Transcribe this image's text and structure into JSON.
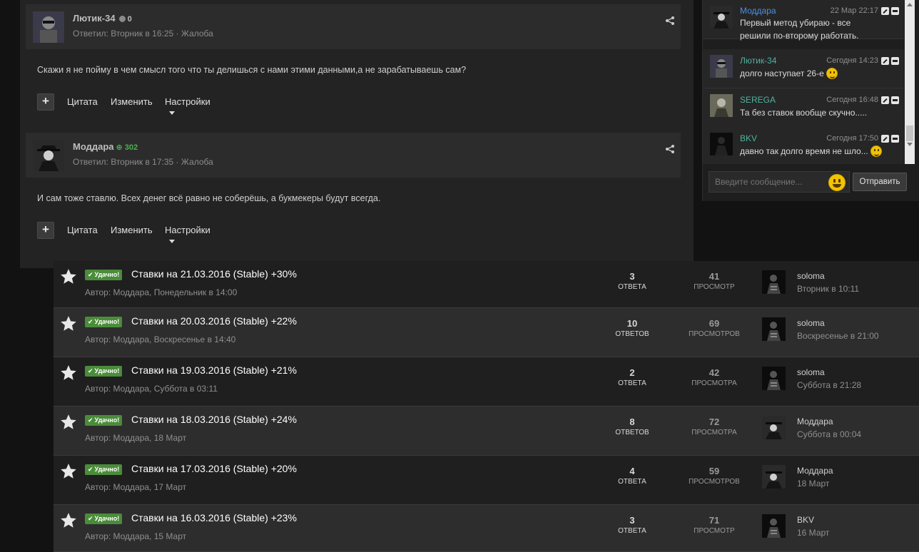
{
  "posts": [
    {
      "author": "Лютик-34",
      "rep": "0",
      "rep_positive": false,
      "meta_prefix": "Ответил: Вторник в 16:25",
      "complaint": "Жалоба",
      "text": "Скажи я не пойму в чем смысл того что ты делишься с нами этими данными,а не зарабатываешь сам?",
      "actions": {
        "quote": "Цитата",
        "edit": "Изменить",
        "settings": "Настройки"
      }
    },
    {
      "author": "Моддара",
      "rep": "302",
      "rep_positive": true,
      "meta_prefix": "Ответил: Вторник в 17:35",
      "complaint": "Жалоба",
      "text": "И сам тоже ставлю. Всех денег всё равно не соберёшь, а букмекеры будут всегда.",
      "actions": {
        "quote": "Цитата",
        "edit": "Изменить",
        "settings": "Настройки"
      }
    }
  ],
  "chat": {
    "messages": [
      {
        "author": "Моддара",
        "color": "#4a90e2",
        "time": "22 Мар 22:17",
        "text": "Первый метод убираю - все решили по-второму работать.",
        "smiley": false
      },
      {
        "author": "Лютик-34",
        "color": "#4fb3a0",
        "time": "Сегодня 14:23",
        "text": "долго наступает 26-е",
        "smiley": true
      },
      {
        "author": "SEREGA",
        "color": "#4fb3a0",
        "time": "Сегодня 16:48",
        "text": "Та без ставок вообще скучно.....",
        "smiley": false
      },
      {
        "author": "BKV",
        "color": "#4fb3a0",
        "time": "Сегодня 17:50",
        "text": "давно так долго время не шло...",
        "smiley": true
      }
    ],
    "input_placeholder": "Введите сообщение...",
    "send_label": "Отправить"
  },
  "topics": [
    {
      "badge": "Удачно!",
      "title": "Ставки на 21.03.2016 (Stable) +30%",
      "author_line": "Автор: Моддара, Понедельник в 14:00",
      "replies": "3",
      "replies_label": "ОТВЕТА",
      "views": "41",
      "views_label": "ПРОСМОТР",
      "last_user": "soloma",
      "last_time": "Вторник в 10:11"
    },
    {
      "badge": "Удачно!",
      "title": "Ставки на 20.03.2016 (Stable) +22%",
      "author_line": "Автор: Моддара, Воскресенье в 14:40",
      "replies": "10",
      "replies_label": "ОТВЕТОВ",
      "views": "69",
      "views_label": "ПРОСМОТРОВ",
      "last_user": "soloma",
      "last_time": "Воскресенье в 21:00"
    },
    {
      "badge": "Удачно!",
      "title": "Ставки на 19.03.2016 (Stable) +21%",
      "author_line": "Автор: Моддара, Суббота в 03:11",
      "replies": "2",
      "replies_label": "ОТВЕТА",
      "views": "42",
      "views_label": "ПРОСМОТРА",
      "last_user": "soloma",
      "last_time": "Суббота в 21:28"
    },
    {
      "badge": "Удачно!",
      "title": "Ставки на 18.03.2016 (Stable) +24%",
      "author_line": "Автор: Моддара, 18 Март",
      "replies": "8",
      "replies_label": "ОТВЕТОВ",
      "views": "72",
      "views_label": "ПРОСМОТРА",
      "last_user": "Моддара",
      "last_time": "Суббота в 00:04"
    },
    {
      "badge": "Удачно!",
      "title": "Ставки на 17.03.2016 (Stable) +20%",
      "author_line": "Автор: Моддара, 17 Март",
      "replies": "4",
      "replies_label": "ОТВЕТА",
      "views": "59",
      "views_label": "ПРОСМОТРОВ",
      "last_user": "Моддара",
      "last_time": "18 Март"
    },
    {
      "badge": "Удачно!",
      "title": "Ставки на 16.03.2016 (Stable) +23%",
      "author_line": "Автор: Моддара, 15 Март",
      "replies": "3",
      "replies_label": "ОТВЕТА",
      "views": "71",
      "views_label": "ПРОСМОТР",
      "last_user": "BKV",
      "last_time": "16 Март"
    }
  ]
}
